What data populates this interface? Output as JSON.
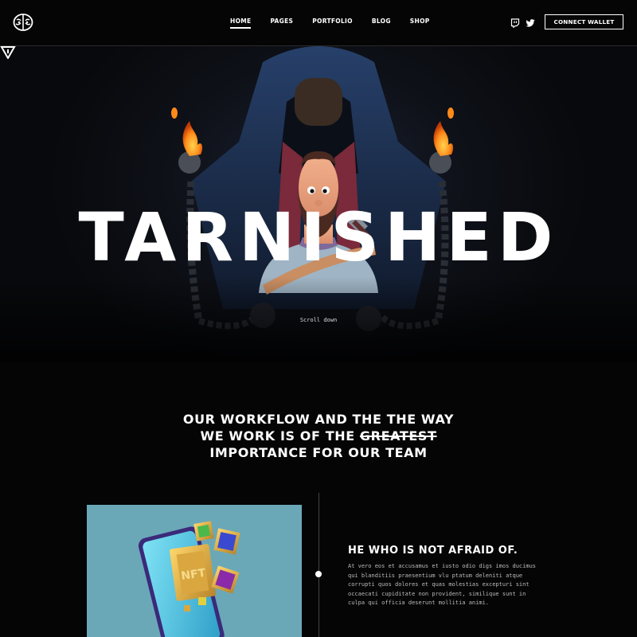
{
  "nav": {
    "items": [
      {
        "label": "HOME",
        "active": true
      },
      {
        "label": "PAGES",
        "active": false
      },
      {
        "label": "PORTFOLIO",
        "active": false
      },
      {
        "label": "BLOG",
        "active": false
      },
      {
        "label": "SHOP",
        "active": false
      }
    ],
    "social": [
      "twitch-icon",
      "twitter-icon"
    ],
    "wallet_label": "CONNECT WALLET"
  },
  "hero": {
    "title": "TARNISHED",
    "scroll_label": "Scroll down"
  },
  "workflow": {
    "line1": "OUR WORKFLOW AND THE THE WAY",
    "line2_pre": "WE WORK IS OF THE ",
    "line2_strike": "GREATEST",
    "line3": "IMPORTANCE FOR OUR TEAM"
  },
  "feature": {
    "title": "HE WHO IS NOT AFRAID OF.",
    "body": "At vero eos et accusamus et iusto odio digs imos ducimus qui blanditiis praesentium vlu ptatum deleniti atque corrupti quos dolores et quas molestias excepturi sint occaecati cupiditate non provident, similique sunt in culpa qui officia deserunt mollitia animi.",
    "image_badge": "NFT"
  },
  "colors": {
    "background": "#050505",
    "card": "#6aa8b8",
    "accent": "#ffffff"
  }
}
